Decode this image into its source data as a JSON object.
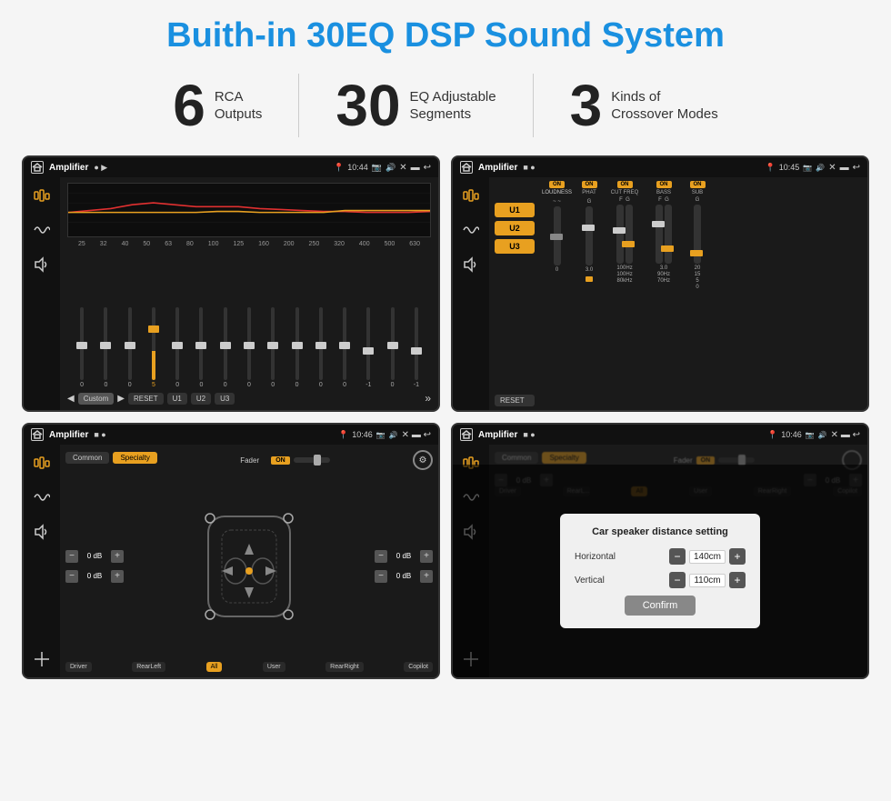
{
  "page": {
    "title": "Buith-in 30EQ DSP Sound System",
    "title_color": "#1a90e0"
  },
  "stats": [
    {
      "number": "6",
      "label_line1": "RCA",
      "label_line2": "Outputs"
    },
    {
      "number": "30",
      "label_line1": "EQ Adjustable",
      "label_line2": "Segments"
    },
    {
      "number": "3",
      "label_line1": "Kinds of",
      "label_line2": "Crossover Modes"
    }
  ],
  "screen1": {
    "app_title": "Amplifier",
    "time": "10:44",
    "eq_freqs": [
      "25",
      "32",
      "40",
      "50",
      "63",
      "80",
      "100",
      "125",
      "160",
      "200",
      "250",
      "320",
      "400",
      "500",
      "630"
    ],
    "eq_values": [
      "0",
      "0",
      "0",
      "5",
      "0",
      "0",
      "0",
      "0",
      "0",
      "0",
      "0",
      "0",
      "-1",
      "0",
      "-1"
    ],
    "buttons": [
      "Custom",
      "RESET",
      "U1",
      "U2",
      "U3"
    ]
  },
  "screen2": {
    "app_title": "Amplifier",
    "time": "10:45",
    "presets": [
      "U1",
      "U2",
      "U3"
    ],
    "channels": [
      {
        "on": true,
        "name": "LOUDNESS"
      },
      {
        "on": true,
        "name": "PHAT"
      },
      {
        "on": true,
        "name": "CUT FREQ"
      },
      {
        "on": true,
        "name": "BASS"
      },
      {
        "on": true,
        "name": "SUB"
      }
    ],
    "reset_label": "RESET"
  },
  "screen3": {
    "app_title": "Amplifier",
    "time": "10:46",
    "tabs": [
      {
        "label": "Common",
        "active": false
      },
      {
        "label": "Specialty",
        "active": true
      }
    ],
    "fader_label": "Fader",
    "fader_on": "ON",
    "volume_controls": [
      {
        "value": "0 dB"
      },
      {
        "value": "0 dB"
      },
      {
        "value": "0 dB"
      },
      {
        "value": "0 dB"
      }
    ],
    "bottom_labels": [
      "Driver",
      "RearLeft",
      "All",
      "User",
      "RearRight",
      "Copilot"
    ]
  },
  "screen4": {
    "app_title": "Amplifier",
    "time": "10:46",
    "tabs": [
      {
        "label": "Common",
        "active": false
      },
      {
        "label": "Specialty",
        "active": true
      }
    ],
    "fader_on": "ON",
    "dialog": {
      "title": "Car speaker distance setting",
      "horizontal_label": "Horizontal",
      "horizontal_value": "140cm",
      "vertical_label": "Vertical",
      "vertical_value": "110cm",
      "confirm_label": "Confirm"
    },
    "volume_controls": [
      {
        "value": "0 dB"
      },
      {
        "value": "0 dB"
      }
    ],
    "bottom_labels": [
      "Driver",
      "RearLeft",
      "All",
      "User",
      "RearRight",
      "Copilot"
    ]
  }
}
